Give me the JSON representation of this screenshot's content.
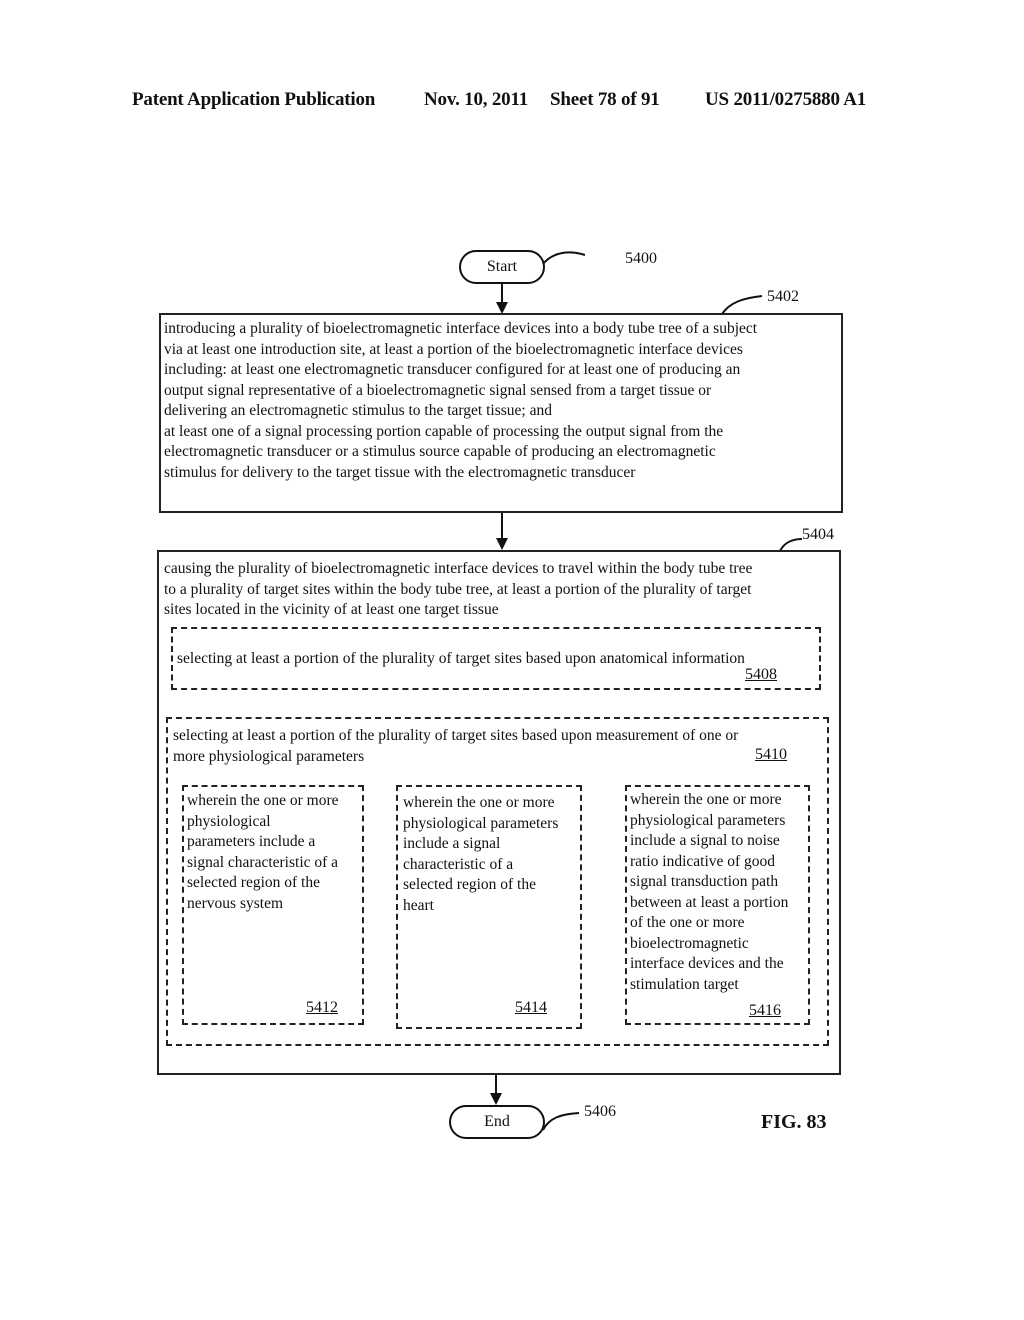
{
  "header": {
    "left": "Patent Application Publication",
    "date": "Nov. 10, 2011",
    "sheet": "Sheet 78 of 91",
    "pub_number": "US 2011/0275880 A1"
  },
  "flowchart": {
    "ref": "5400",
    "start": {
      "label": "Start"
    },
    "end": {
      "label": "End",
      "ref": "5406"
    },
    "step1": {
      "ref": "5402",
      "text": "introducing a plurality of bioelectromagnetic interface devices into a body tube tree of a subject\nvia at least one introduction site, at least a portion of the bioelectromagnetic interface devices\nincluding: at least one electromagnetic transducer configured for at least one of producing an\noutput signal representative of a bioelectromagnetic signal sensed from a target tissue or\ndelivering an electromagnetic stimulus to the target tissue; and\nat least one of a signal processing portion capable of processing the output signal from the\nelectromagnetic transducer or a stimulus source capable of producing an electromagnetic\nstimulus for delivery to the target tissue with the electromagnetic transducer"
    },
    "step2": {
      "ref": "5404",
      "text": "causing the plurality of bioelectromagnetic interface devices to travel within the body tube tree\nto a plurality of target sites within the body tube tree, at least a portion of the plurality of target\nsites located in the vicinity of at least one target tissue",
      "option_a": {
        "ref": "5408",
        "text": "selecting at least a portion of the plurality of target sites based upon anatomical information"
      },
      "option_b": {
        "ref": "5410",
        "text": "selecting at least a portion of the plurality of target sites based upon measurement of one or\nmore physiological parameters",
        "sub": [
          {
            "ref": "5412",
            "text": "wherein the one or more\nphysiological\nparameters include a\nsignal characteristic of a\nselected region of the\nnervous system"
          },
          {
            "ref": "5414",
            "text": "wherein the one or more\nphysiological parameters\ninclude a signal\ncharacteristic of a\nselected region of the\nheart"
          },
          {
            "ref": "5416",
            "text": "wherein the one or more\nphysiological parameters\ninclude a signal to noise\nratio indicative of good\nsignal transduction path\nbetween at least a portion\nof the one or more\nbioelectromagnetic\ninterface devices and the\nstimulation target"
          }
        ]
      }
    }
  },
  "figure_label": "FIG. 83"
}
